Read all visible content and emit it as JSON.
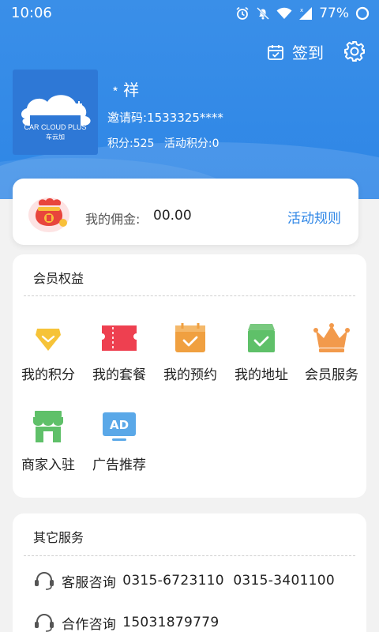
{
  "status_bar": {
    "time": "10:06",
    "battery": "77%"
  },
  "header": {
    "checkin_label": "签到",
    "username": "﹡祥",
    "invite_code": "邀请码:1533325****",
    "points": "积分:525",
    "activity_points": "活动积分:0",
    "logo": {
      "text": "CAR CLOUD PLUS",
      "subtext": "车云加"
    }
  },
  "commission": {
    "label": "我的佣金:",
    "value": "00.00",
    "rules_link": "活动规则"
  },
  "benefits": {
    "title": "会员权益",
    "items": [
      {
        "label": "我的积分",
        "icon": "diamond-icon"
      },
      {
        "label": "我的套餐",
        "icon": "ticket-icon"
      },
      {
        "label": "我的预约",
        "icon": "calendar-check-icon"
      },
      {
        "label": "我的地址",
        "icon": "box-check-icon"
      },
      {
        "label": "会员服务",
        "icon": "crown-icon"
      },
      {
        "label": "商家入驻",
        "icon": "store-icon"
      },
      {
        "label": "广告推荐",
        "icon": "ad-icon"
      }
    ]
  },
  "services": {
    "title": "其它服务",
    "rows": [
      {
        "label": "客服咨询",
        "value": "0315-6723110  0315-3401100",
        "icon": "headset-icon"
      },
      {
        "label": "合作咨询",
        "value": "15031879779",
        "icon": "headset-icon"
      }
    ]
  },
  "colors": {
    "primary": "#2e86e6",
    "yellow": "#f6c338",
    "red": "#ee4050",
    "orange": "#f0a040",
    "green": "#5fc069",
    "crown": "#f29a4c",
    "ad": "#5aa8e8"
  }
}
